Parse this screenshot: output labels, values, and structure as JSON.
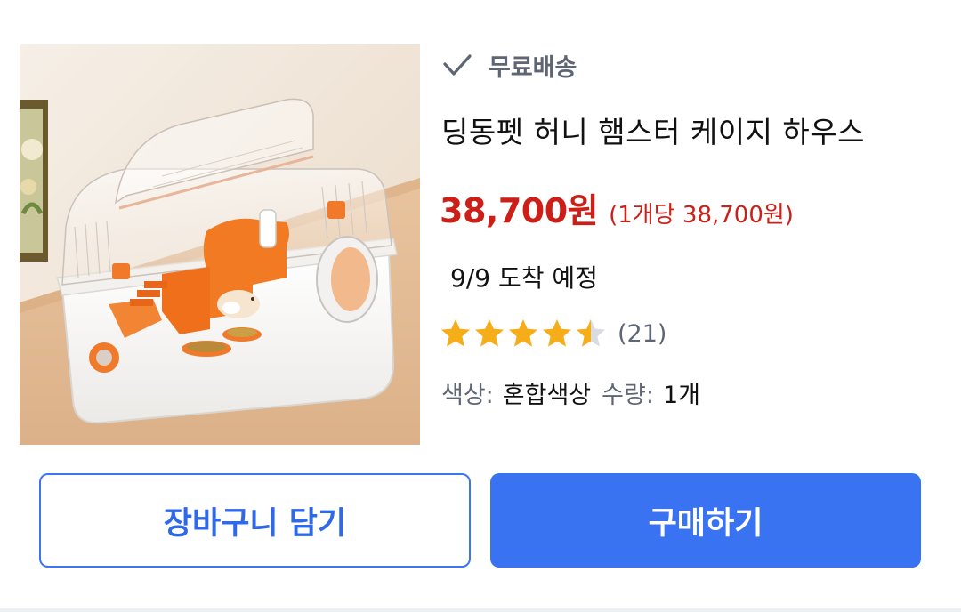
{
  "shipping": {
    "icon": "check-icon",
    "label": "무료배송",
    "color": "#5e6673"
  },
  "product": {
    "title": "딩동펫 허니 햄스터 케이지 하우스",
    "price": "38,700원",
    "unit_price": "(1개당 38,700원)",
    "price_color": "#cc1f18",
    "delivery": "9/9 도착 예정",
    "rating": 4.5,
    "review_count": "(21)",
    "options": {
      "color_label": "색상:",
      "color_value": "혼합색상",
      "qty_label": "수량:",
      "qty_value": "1개"
    }
  },
  "buttons": {
    "cart_label": "장바구니 담기",
    "buy_label": "구매하기",
    "accent": "#3a73f2"
  }
}
